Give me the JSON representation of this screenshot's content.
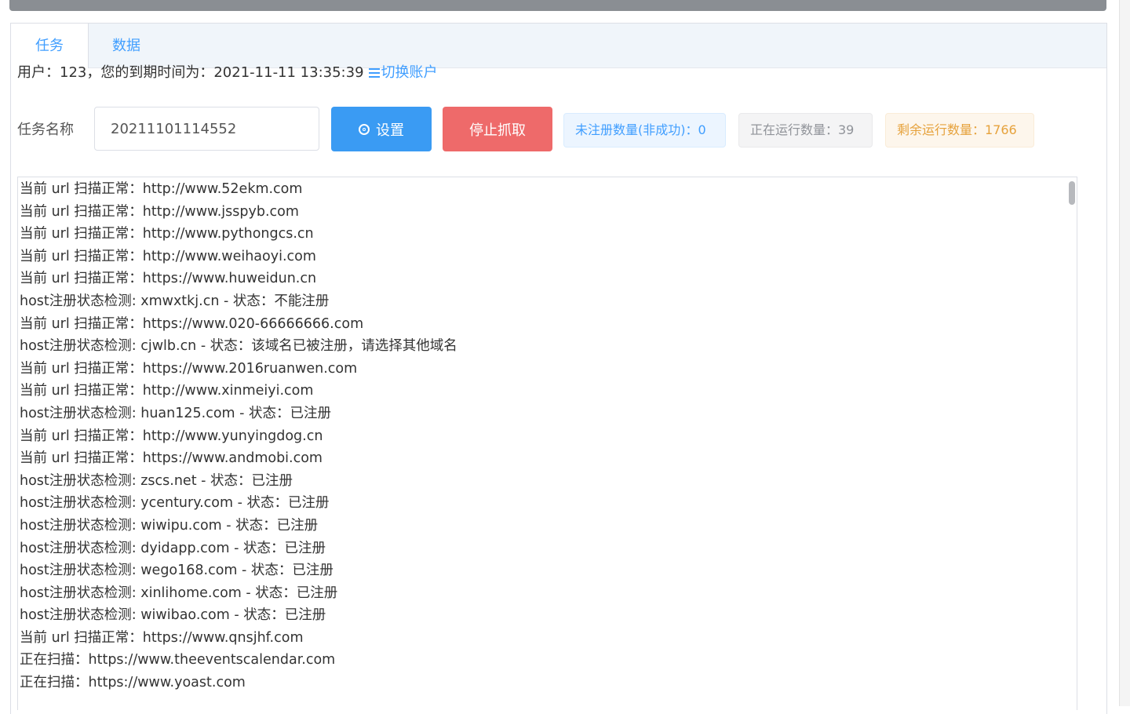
{
  "tabs": [
    {
      "label": "任务",
      "active": true
    },
    {
      "label": "数据",
      "active": false
    }
  ],
  "user": {
    "info": "用户：123，您的到期时间为：2021-11-11 13:35:39",
    "switch_label": "切换账户"
  },
  "task": {
    "label": "任务名称",
    "name_value": "20211101114552",
    "settings_label": "设置",
    "stop_label": "停止抓取"
  },
  "stats": {
    "unregistered": "未注册数量(非成功)：0",
    "running": "正在运行数量：39",
    "remaining": "剩余运行数量：1766"
  },
  "colors": {
    "primary": "#409eff",
    "danger": "#ee6a6a",
    "warning": "#e6a23c",
    "info": "#909399"
  },
  "log_lines": [
    "当前 url 扫描正常：http://www.52ekm.com",
    "当前 url 扫描正常：http://www.jsspyb.com",
    "当前 url 扫描正常：http://www.pythongcs.cn",
    "当前 url 扫描正常：http://www.weihaoyi.com",
    "当前 url 扫描正常：https://www.huweidun.cn",
    "host注册状态检测: xmwxtkj.cn - 状态：不能注册",
    "当前 url 扫描正常：https://www.020-66666666.com",
    "host注册状态检测: cjwlb.cn - 状态：该域名已被注册，请选择其他域名",
    "当前 url 扫描正常：https://www.2016ruanwen.com",
    "当前 url 扫描正常：http://www.xinmeiyi.com",
    "host注册状态检测: huan125.com - 状态：已注册",
    "当前 url 扫描正常：http://www.yunyingdog.cn",
    "当前 url 扫描正常：https://www.andmobi.com",
    "host注册状态检测: zscs.net - 状态：已注册",
    "host注册状态检测: ycentury.com - 状态：已注册",
    "host注册状态检测: wiwipu.com - 状态：已注册",
    "host注册状态检测: dyidapp.com - 状态：已注册",
    "host注册状态检测: wego168.com - 状态：已注册",
    "host注册状态检测: xinlihome.com - 状态：已注册",
    "host注册状态检测: wiwibao.com - 状态：已注册",
    "当前 url 扫描正常：https://www.qnsjhf.com",
    "正在扫描：https://www.theeventscalendar.com",
    "正在扫描：https://www.yoast.com"
  ]
}
